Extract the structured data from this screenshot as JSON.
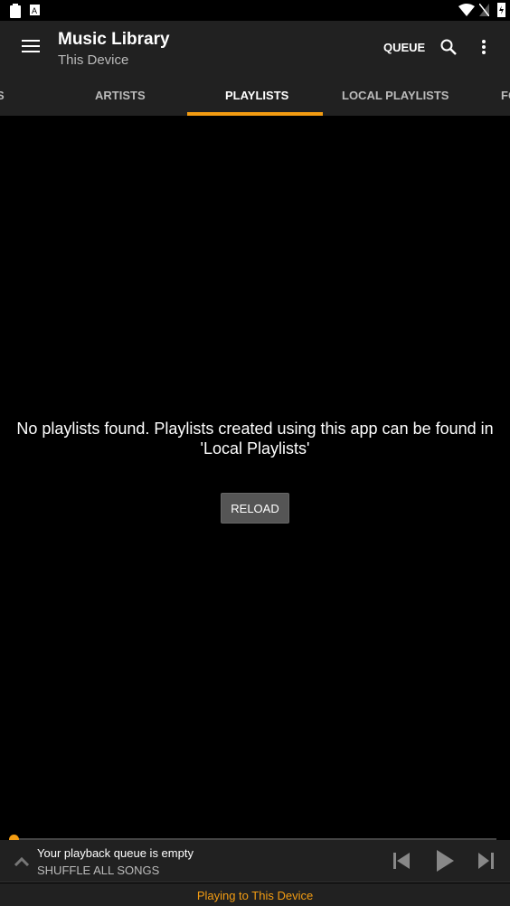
{
  "appbar": {
    "title": "Music Library",
    "subtitle": "This Device",
    "queue_label": "QUEUE"
  },
  "tabs": [
    {
      "label": "S"
    },
    {
      "label": "ARTISTS"
    },
    {
      "label": "PLAYLISTS",
      "active": true
    },
    {
      "label": "LOCAL PLAYLISTS"
    },
    {
      "label": "FO"
    }
  ],
  "main": {
    "empty_message": "No playlists found. Playlists created using this app can be found in 'Local Playlists'",
    "reload_label": "RELOAD"
  },
  "player": {
    "title": "Your playback queue is empty",
    "subtitle": "SHUFFLE ALL SONGS",
    "progress": 0
  },
  "footer": {
    "text": "Playing to This Device"
  },
  "colors": {
    "accent": "#f39c12",
    "appbar": "#212121",
    "background": "#000000"
  }
}
